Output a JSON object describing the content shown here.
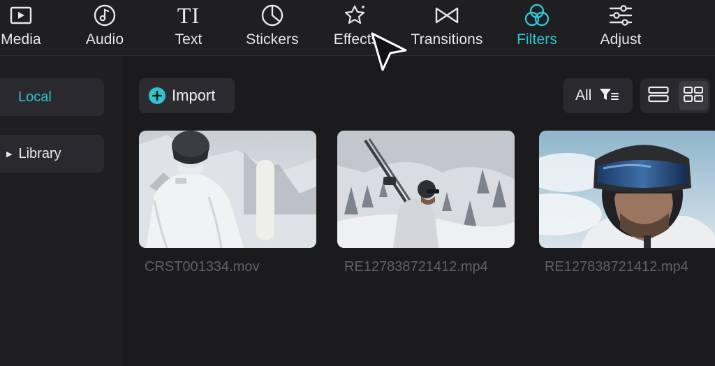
{
  "toolbar": {
    "items": [
      {
        "label": "Media",
        "icon": "media-icon"
      },
      {
        "label": "Audio",
        "icon": "audio-icon"
      },
      {
        "label": "Text",
        "icon": "text-icon"
      },
      {
        "label": "Stickers",
        "icon": "stickers-icon"
      },
      {
        "label": "Effects",
        "icon": "effects-icon"
      },
      {
        "label": "Transitions",
        "icon": "transitions-icon"
      },
      {
        "label": "Filters",
        "icon": "filters-icon",
        "active": true
      },
      {
        "label": "Adjust",
        "icon": "adjust-icon"
      }
    ],
    "text_icon_glyph": "TI"
  },
  "sidebar": {
    "local_label": "Local",
    "library_label": "Library",
    "library_caret": "▶"
  },
  "main": {
    "import_label": "Import",
    "filter_label": "All",
    "view_modes": [
      "list-view",
      "grid-view"
    ],
    "active_view": "grid-view"
  },
  "media": [
    {
      "filename": "CRST001334.mov"
    },
    {
      "filename": "RE127838721412.mp4"
    },
    {
      "filename": "RE127838721412.mp4"
    }
  ],
  "colors": {
    "accent": "#2fc4d0",
    "background": "#1b1b1d",
    "panel": "#1f1f22"
  }
}
